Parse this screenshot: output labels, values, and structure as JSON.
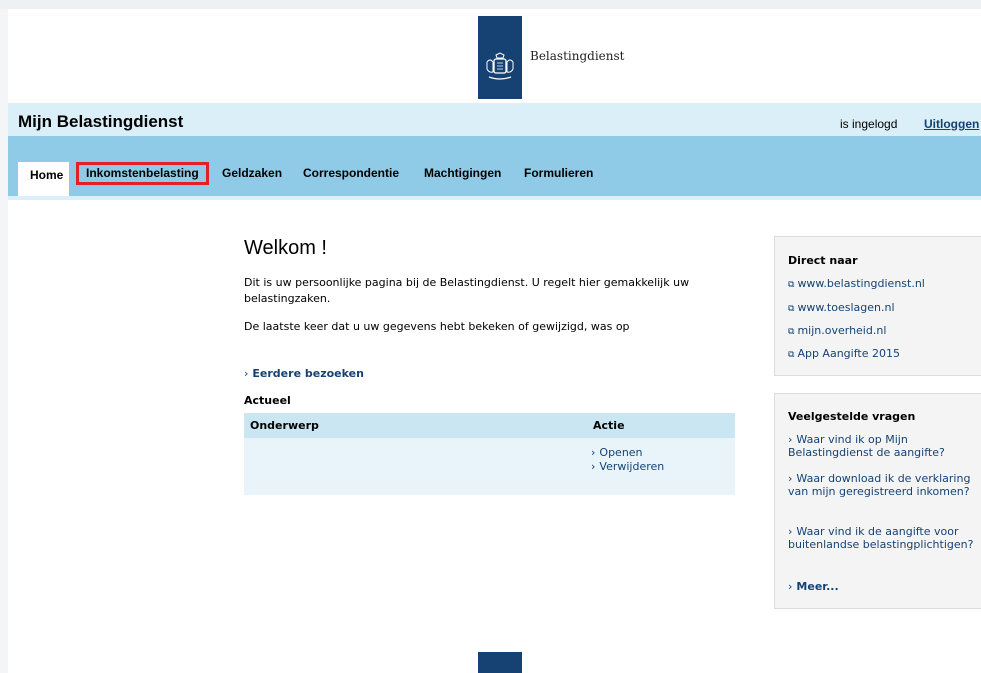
{
  "header": {
    "brand": "Belastingdienst"
  },
  "titlebar": {
    "title": "Mijn Belastingdienst",
    "status": "is ingelogd",
    "logout": "Uitloggen"
  },
  "nav": {
    "items": [
      "Home",
      "Inkomstenbelasting",
      "Geldzaken",
      "Correspondentie",
      "Machtigingen",
      "Formulieren"
    ]
  },
  "main": {
    "welcome": "Welkom !",
    "intro": "Dit is uw persoonlijke pagina bij de Belastingdienst. U regelt hier gemakkelijk uw belastingzaken.",
    "last_visit": "De laatste keer dat u uw gegevens hebt bekeken of gewijzigd, was op",
    "earlier_visits": "Eerdere bezoeken",
    "actueel": "Actueel",
    "table": {
      "col_subject": "Onderwerp",
      "col_action": "Actie",
      "actions": [
        "Openen",
        "Verwijderen"
      ]
    }
  },
  "sidebar": {
    "direct": {
      "title": "Direct naar",
      "links": [
        "www.belastingdienst.nl",
        "www.toeslagen.nl",
        "mijn.overheid.nl",
        "App Aangifte 2015"
      ]
    },
    "faq": {
      "title": "Veelgestelde vragen",
      "items": [
        "Waar vind ik op Mijn Belastingdienst de aangifte?",
        "Waar download ik de verklaring van mijn geregistreerd inkomen?",
        "Waar vind ik de aangifte voor buitenlandse belastingplichtigen?"
      ],
      "more": "Meer..."
    }
  },
  "colors": {
    "brand_blue": "#154273",
    "nav_blue": "#8fcae7",
    "light_blue": "#dbeff8",
    "highlight_red": "#e3202a"
  }
}
